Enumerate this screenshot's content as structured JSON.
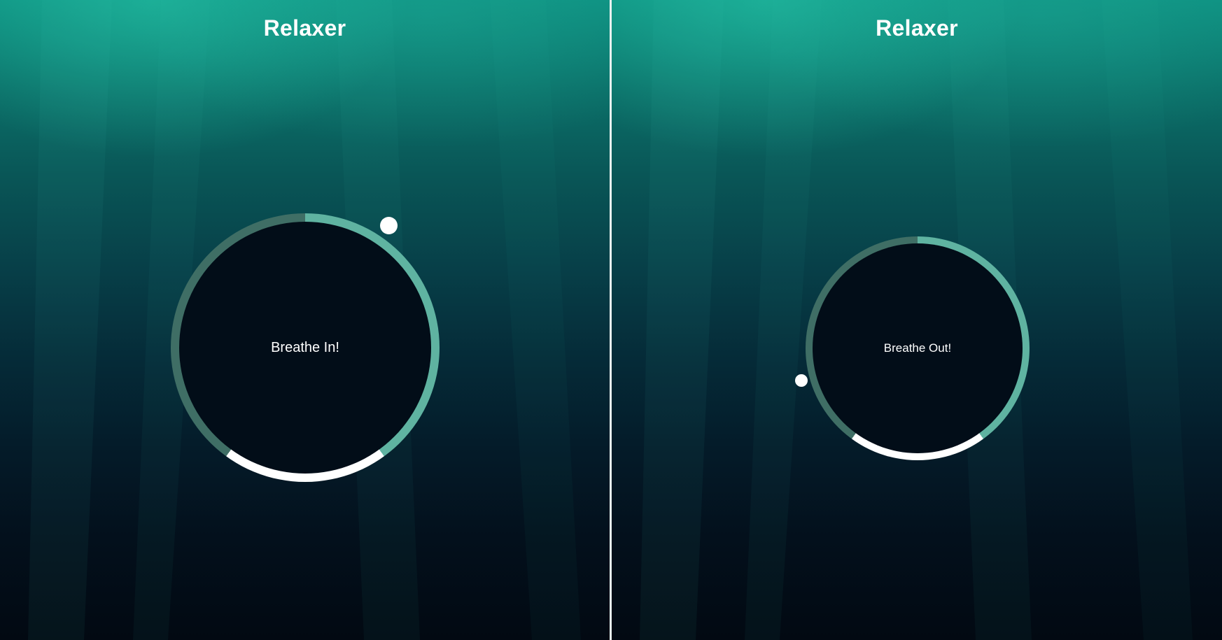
{
  "left": {
    "app_title": "Relaxer",
    "instruction": "Breathe In!"
  },
  "right": {
    "app_title": "Relaxer",
    "instruction": "Breathe Out!"
  },
  "colors": {
    "ring_breathe_in": "#5fb3a1",
    "ring_hold": "#3f6e65",
    "ring_breathe_out": "#ffffff",
    "inner_circle": "#020d18",
    "pointer": "#ffffff"
  }
}
